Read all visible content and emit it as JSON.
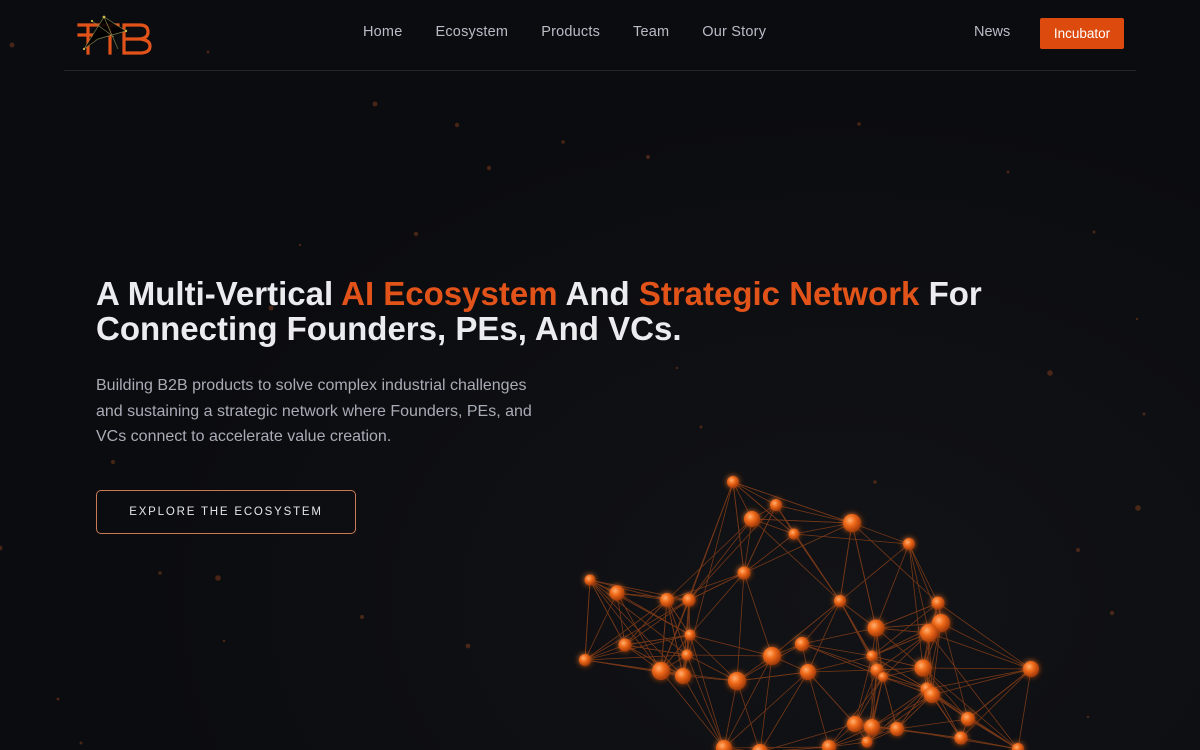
{
  "header": {
    "logo_text": "FTB",
    "nav": [
      {
        "label": "Home"
      },
      {
        "label": "Ecosystem"
      },
      {
        "label": "Products"
      },
      {
        "label": "Team"
      },
      {
        "label": "Our Story"
      }
    ],
    "news_label": "News",
    "incubator_label": "Incubator"
  },
  "hero": {
    "title_part1": "A Multi-Vertical ",
    "title_accent1": "AI Ecosystem",
    "title_part2": " And ",
    "title_accent2": "Strategic Network",
    "title_part3": " For Connecting Founders, PEs, And VCs.",
    "subtitle": "Building B2B products to solve complex industrial challenges and sustaining a strategic network where Founders, PEs, and VCs connect to accelerate value creation.",
    "cta_label": "EXPLORE THE ECOSYSTEM"
  },
  "colors": {
    "background": "#0b0c10",
    "accent": "#dc4a0e",
    "node": "#f06a1a",
    "link": "#c8561a"
  },
  "icons": [
    "ftb-logo"
  ]
}
